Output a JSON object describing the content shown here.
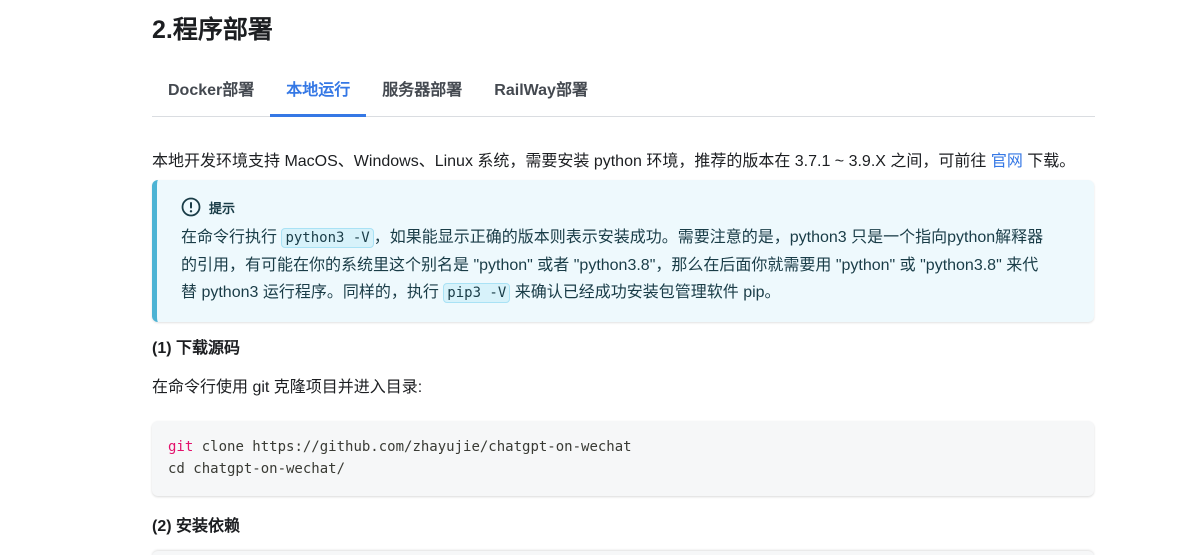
{
  "section": {
    "title": "2.程序部署"
  },
  "tabs": [
    {
      "label": "Docker部署",
      "active": false
    },
    {
      "label": "本地运行",
      "active": true
    },
    {
      "label": "服务器部署",
      "active": false
    },
    {
      "label": "RailWay部署",
      "active": false
    }
  ],
  "intro": {
    "text_before_link": "本地开发环境支持 MacOS、Windows、Linux 系统，需要安装 python 环境，推荐的版本在 3.7.1 ~ 3.9.X 之间，可前往 ",
    "link_label": "官网",
    "text_after_link": " 下载。"
  },
  "tip": {
    "icon": "info-icon",
    "title": "提示",
    "line1_prefix": "在命令行执行 ",
    "line1_code": "python3 -V",
    "line1_suffix": "，如果能显示正确的版本则表示安装成功。需要注意的是，python3 只是一个指向python解释器",
    "line2": "的引用，有可能在你的系统里这个别名是 \"python\" 或者 \"python3.8\"，那么在后面你就需要用 \"python\" 或 \"python3.8\" 来代",
    "line3_prefix": "替 python3 运行程序。同样的，执行 ",
    "line3_code": "pip3 -V",
    "line3_suffix": " 来确认已经成功安装包管理软件 pip。"
  },
  "step1": {
    "heading": "(1) 下载源码",
    "text": "在命令行使用 git 克隆项目并进入目录:",
    "code_line1_cmd": "git",
    "code_line1_rest": " clone https://github.com/zhayujie/chatgpt-on-wechat",
    "code_line2": "cd chatgpt-on-wechat/"
  },
  "step2": {
    "heading": "(2) 安装依赖"
  },
  "colors": {
    "accent": "#3578e5",
    "tip_border": "#4cb3d4",
    "tip_background": "#eef9fd",
    "code_command": "#e3116c"
  }
}
